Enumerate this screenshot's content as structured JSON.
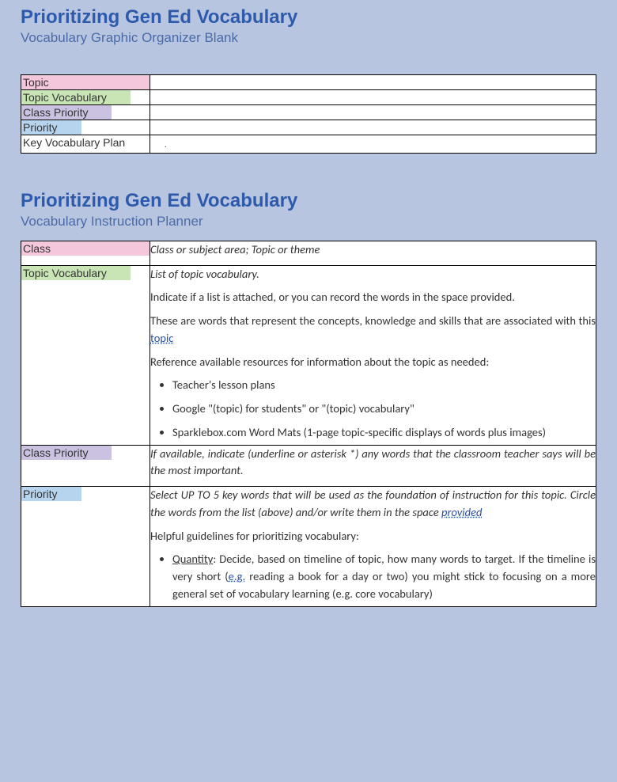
{
  "section1": {
    "title": "Prioritizing Gen Ed Vocabulary",
    "subtitle": "Vocabulary Graphic Organizer Blank",
    "rows": {
      "topic": "Topic",
      "topic_vocab": "Topic Vocabulary",
      "class_priority": "Class Priority",
      "priority": "Priority",
      "key_plan": "Key Vocabulary Plan",
      "key_plan_content": "."
    }
  },
  "section2": {
    "title": "Prioritizing Gen Ed Vocabulary",
    "subtitle": "Vocabulary Instruction Planner",
    "class": {
      "label": "Class",
      "desc": "Class or subject area; Topic or theme"
    },
    "topic_vocab": {
      "label": "Topic Vocabulary",
      "intro": "List of topic vocabulary.",
      "l2a": "Indicate if a list is attached, or you can record the words in the space provided.",
      "l2b_pre": "These are words that represent the concepts, knowledge and skills that are associated with this ",
      "l2b_link": "topic",
      "l3": "Reference available resources for information about the topic as needed:",
      "b1": "Teacher's lesson plans",
      "b2": "Google \"(topic) for students\" or \"(topic) vocabulary\"",
      "b3": "Sparklebox.com Word Mats (1-page topic-specific displays of words plus images)"
    },
    "class_priority": {
      "label": "Class Priority",
      "desc": "If available, indicate (underline or asterisk *) any words that the classroom teacher says will be the most important."
    },
    "priority": {
      "label": "Priority",
      "l1_pre": "Select UP TO 5 key words that will be used as the foundation of instruction for this topic. Circle the words from the list (above) and/or write them in the space ",
      "l1_link": "provided",
      "l2": "Helpful guidelines for prioritizing vocabulary:",
      "b1_lead": "Quantity",
      "b1_rest_a": ": Decide, based on timeline of topic, how many words to target. If the timeline is very short (",
      "b1_link": "e.g.",
      "b1_rest_b": " reading a book for a day or two) you might stick to focusing on a more general set of vocabulary learning (e.g. core vocabulary)"
    }
  }
}
